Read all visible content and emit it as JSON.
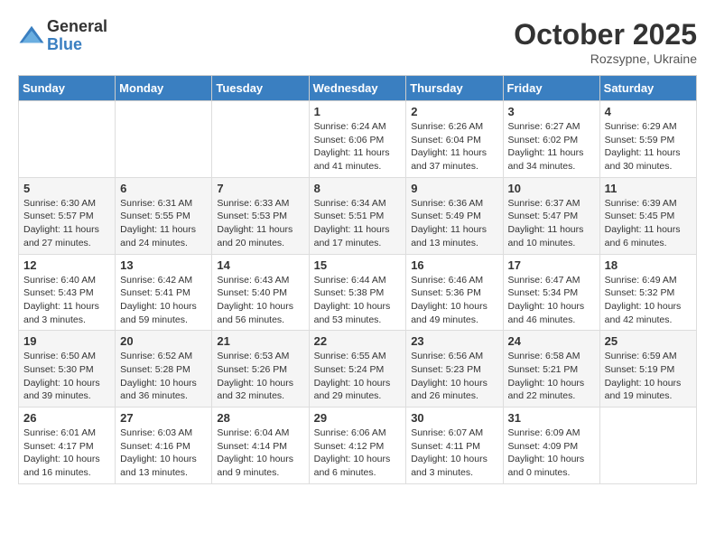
{
  "logo": {
    "general": "General",
    "blue": "Blue"
  },
  "title": "October 2025",
  "subtitle": "Rozsypne, Ukraine",
  "days_of_week": [
    "Sunday",
    "Monday",
    "Tuesday",
    "Wednesday",
    "Thursday",
    "Friday",
    "Saturday"
  ],
  "weeks": [
    [
      {
        "day": "",
        "info": ""
      },
      {
        "day": "",
        "info": ""
      },
      {
        "day": "",
        "info": ""
      },
      {
        "day": "1",
        "info": "Sunrise: 6:24 AM\nSunset: 6:06 PM\nDaylight: 11 hours\nand 41 minutes."
      },
      {
        "day": "2",
        "info": "Sunrise: 6:26 AM\nSunset: 6:04 PM\nDaylight: 11 hours\nand 37 minutes."
      },
      {
        "day": "3",
        "info": "Sunrise: 6:27 AM\nSunset: 6:02 PM\nDaylight: 11 hours\nand 34 minutes."
      },
      {
        "day": "4",
        "info": "Sunrise: 6:29 AM\nSunset: 5:59 PM\nDaylight: 11 hours\nand 30 minutes."
      }
    ],
    [
      {
        "day": "5",
        "info": "Sunrise: 6:30 AM\nSunset: 5:57 PM\nDaylight: 11 hours\nand 27 minutes."
      },
      {
        "day": "6",
        "info": "Sunrise: 6:31 AM\nSunset: 5:55 PM\nDaylight: 11 hours\nand 24 minutes."
      },
      {
        "day": "7",
        "info": "Sunrise: 6:33 AM\nSunset: 5:53 PM\nDaylight: 11 hours\nand 20 minutes."
      },
      {
        "day": "8",
        "info": "Sunrise: 6:34 AM\nSunset: 5:51 PM\nDaylight: 11 hours\nand 17 minutes."
      },
      {
        "day": "9",
        "info": "Sunrise: 6:36 AM\nSunset: 5:49 PM\nDaylight: 11 hours\nand 13 minutes."
      },
      {
        "day": "10",
        "info": "Sunrise: 6:37 AM\nSunset: 5:47 PM\nDaylight: 11 hours\nand 10 minutes."
      },
      {
        "day": "11",
        "info": "Sunrise: 6:39 AM\nSunset: 5:45 PM\nDaylight: 11 hours\nand 6 minutes."
      }
    ],
    [
      {
        "day": "12",
        "info": "Sunrise: 6:40 AM\nSunset: 5:43 PM\nDaylight: 11 hours\nand 3 minutes."
      },
      {
        "day": "13",
        "info": "Sunrise: 6:42 AM\nSunset: 5:41 PM\nDaylight: 10 hours\nand 59 minutes."
      },
      {
        "day": "14",
        "info": "Sunrise: 6:43 AM\nSunset: 5:40 PM\nDaylight: 10 hours\nand 56 minutes."
      },
      {
        "day": "15",
        "info": "Sunrise: 6:44 AM\nSunset: 5:38 PM\nDaylight: 10 hours\nand 53 minutes."
      },
      {
        "day": "16",
        "info": "Sunrise: 6:46 AM\nSunset: 5:36 PM\nDaylight: 10 hours\nand 49 minutes."
      },
      {
        "day": "17",
        "info": "Sunrise: 6:47 AM\nSunset: 5:34 PM\nDaylight: 10 hours\nand 46 minutes."
      },
      {
        "day": "18",
        "info": "Sunrise: 6:49 AM\nSunset: 5:32 PM\nDaylight: 10 hours\nand 42 minutes."
      }
    ],
    [
      {
        "day": "19",
        "info": "Sunrise: 6:50 AM\nSunset: 5:30 PM\nDaylight: 10 hours\nand 39 minutes."
      },
      {
        "day": "20",
        "info": "Sunrise: 6:52 AM\nSunset: 5:28 PM\nDaylight: 10 hours\nand 36 minutes."
      },
      {
        "day": "21",
        "info": "Sunrise: 6:53 AM\nSunset: 5:26 PM\nDaylight: 10 hours\nand 32 minutes."
      },
      {
        "day": "22",
        "info": "Sunrise: 6:55 AM\nSunset: 5:24 PM\nDaylight: 10 hours\nand 29 minutes."
      },
      {
        "day": "23",
        "info": "Sunrise: 6:56 AM\nSunset: 5:23 PM\nDaylight: 10 hours\nand 26 minutes."
      },
      {
        "day": "24",
        "info": "Sunrise: 6:58 AM\nSunset: 5:21 PM\nDaylight: 10 hours\nand 22 minutes."
      },
      {
        "day": "25",
        "info": "Sunrise: 6:59 AM\nSunset: 5:19 PM\nDaylight: 10 hours\nand 19 minutes."
      }
    ],
    [
      {
        "day": "26",
        "info": "Sunrise: 6:01 AM\nSunset: 4:17 PM\nDaylight: 10 hours\nand 16 minutes."
      },
      {
        "day": "27",
        "info": "Sunrise: 6:03 AM\nSunset: 4:16 PM\nDaylight: 10 hours\nand 13 minutes."
      },
      {
        "day": "28",
        "info": "Sunrise: 6:04 AM\nSunset: 4:14 PM\nDaylight: 10 hours\nand 9 minutes."
      },
      {
        "day": "29",
        "info": "Sunrise: 6:06 AM\nSunset: 4:12 PM\nDaylight: 10 hours\nand 6 minutes."
      },
      {
        "day": "30",
        "info": "Sunrise: 6:07 AM\nSunset: 4:11 PM\nDaylight: 10 hours\nand 3 minutes."
      },
      {
        "day": "31",
        "info": "Sunrise: 6:09 AM\nSunset: 4:09 PM\nDaylight: 10 hours\nand 0 minutes."
      },
      {
        "day": "",
        "info": ""
      }
    ]
  ]
}
